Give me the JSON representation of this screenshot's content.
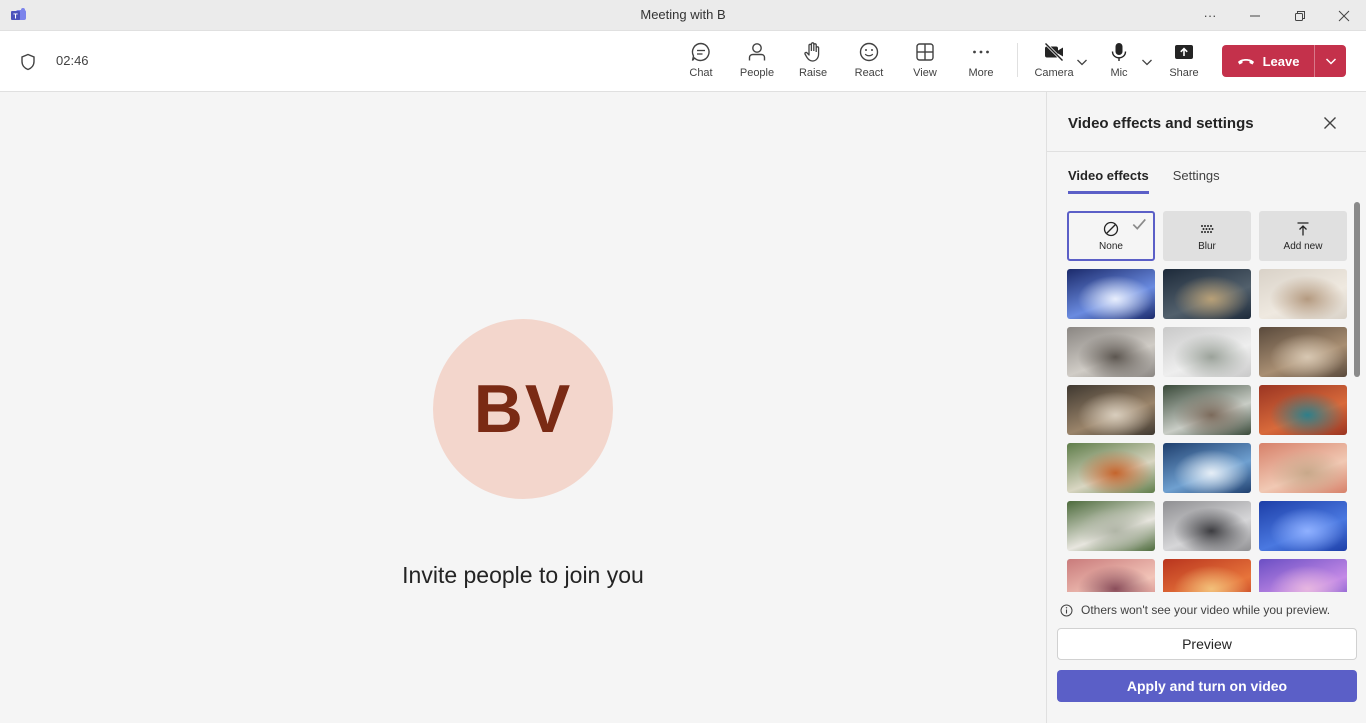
{
  "window": {
    "title": "Meeting with B",
    "controls": {
      "more": "more-options",
      "minimize": "minimize",
      "restore": "restore",
      "close": "close"
    }
  },
  "toolbar": {
    "timer": "02:46",
    "buttons": [
      {
        "id": "chat",
        "label": "Chat",
        "icon": "chat-icon"
      },
      {
        "id": "people",
        "label": "People",
        "icon": "people-icon"
      },
      {
        "id": "raise",
        "label": "Raise",
        "icon": "hand-icon"
      },
      {
        "id": "react",
        "label": "React",
        "icon": "smile-icon"
      },
      {
        "id": "view",
        "label": "View",
        "icon": "grid-icon"
      },
      {
        "id": "more",
        "label": "More",
        "icon": "ellipsis-icon"
      },
      {
        "id": "camera",
        "label": "Camera",
        "icon": "camera-off-icon"
      },
      {
        "id": "mic",
        "label": "Mic",
        "icon": "mic-icon"
      },
      {
        "id": "share",
        "label": "Share",
        "icon": "share-icon"
      }
    ],
    "leave_label": "Leave",
    "leave_color": "#c4314b"
  },
  "stage": {
    "avatar_initials": "BV",
    "avatar_bg": "#f3d6cc",
    "avatar_fg": "#7a2a14",
    "invite_text": "Invite people to join you"
  },
  "panel": {
    "title": "Video effects and settings",
    "tabs": [
      {
        "label": "Video effects",
        "active": true
      },
      {
        "label": "Settings",
        "active": false
      }
    ],
    "options": [
      {
        "label": "None",
        "icon": "none-icon",
        "selected": true
      },
      {
        "label": "Blur",
        "icon": "blur-icon",
        "selected": false
      },
      {
        "label": "Add new",
        "icon": "upload-icon",
        "selected": false
      }
    ],
    "backgrounds": [
      {
        "name": "space-warp",
        "colors": [
          "#1b2a6b",
          "#6a8be0",
          "#e8eefc"
        ]
      },
      {
        "name": "night-sky-lighthouse",
        "colors": [
          "#1d2a3a",
          "#52606c",
          "#b8a077"
        ]
      },
      {
        "name": "minimal-room",
        "colors": [
          "#d9d2c8",
          "#efe9e0",
          "#b49a80"
        ]
      },
      {
        "name": "loft-windows",
        "colors": [
          "#8a8682",
          "#d0ccc6",
          "#5c5650"
        ]
      },
      {
        "name": "white-lounge",
        "colors": [
          "#c9c9c9",
          "#eeeeee",
          "#9ba29a"
        ]
      },
      {
        "name": "wood-study",
        "colors": [
          "#5a4a3c",
          "#a88e72",
          "#d7c7b2"
        ]
      },
      {
        "name": "cozy-interior",
        "colors": [
          "#3f3830",
          "#9a846a",
          "#d8cdbd"
        ]
      },
      {
        "name": "glass-atrium",
        "colors": [
          "#3a4a3a",
          "#c9cdc6",
          "#7b6a5b"
        ]
      },
      {
        "name": "red-courtyard",
        "colors": [
          "#9b3522",
          "#d86a3b",
          "#2e7f8a"
        ]
      },
      {
        "name": "garden-arches",
        "colors": [
          "#5f7d4a",
          "#d9d6c2",
          "#c4642c"
        ]
      },
      {
        "name": "blue-modern",
        "colors": [
          "#1f3f6e",
          "#6fa0d0",
          "#e6eef6"
        ]
      },
      {
        "name": "desert-arch",
        "colors": [
          "#d7816a",
          "#f1c9b4",
          "#c8a88a"
        ]
      },
      {
        "name": "green-circle",
        "colors": [
          "#4d6b3c",
          "#e8e6df",
          "#b0b5a6"
        ]
      },
      {
        "name": "grey-arch",
        "colors": [
          "#8f8f92",
          "#d6d6d8",
          "#3c3c40"
        ]
      },
      {
        "name": "blue-door",
        "colors": [
          "#1d3fa8",
          "#4a78e0",
          "#8fb0ff"
        ]
      },
      {
        "name": "pink-hall",
        "colors": [
          "#c97b7b",
          "#f2c4b8",
          "#8a4d5a"
        ]
      },
      {
        "name": "autumn-forest",
        "colors": [
          "#b9351e",
          "#e7743b",
          "#f2c07a"
        ]
      },
      {
        "name": "purple-fantasy",
        "colors": [
          "#6b4fc4",
          "#c48ae6",
          "#e6b6e0"
        ]
      }
    ],
    "info_text": "Others won't see your video while you preview.",
    "preview_label": "Preview",
    "apply_label": "Apply and turn on video",
    "accent": "#5b5fc7"
  }
}
